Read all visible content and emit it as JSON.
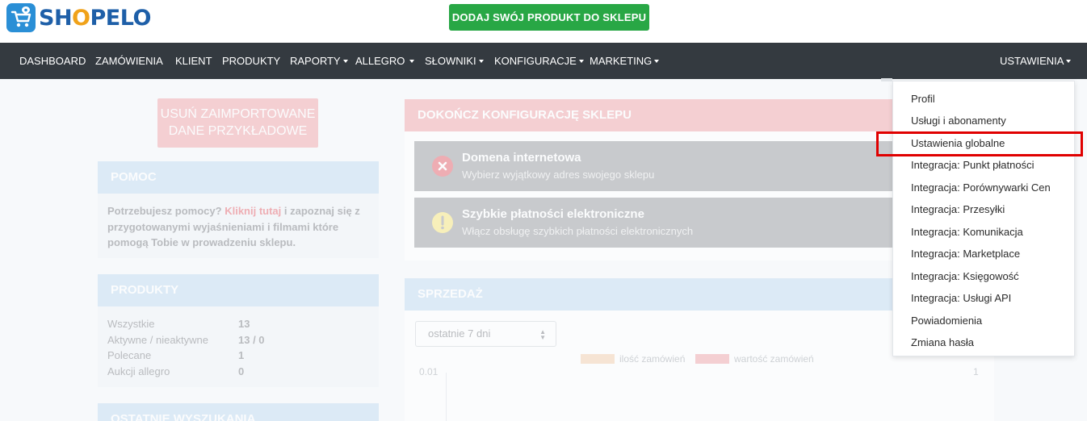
{
  "header": {
    "logo_text_a": "SH",
    "logo_text_o": "O",
    "logo_text_b": "PELO",
    "cta_label": "DODAJ SWÓJ PRODUKT DO SKLEPU"
  },
  "nav": {
    "items": [
      {
        "label": "DASHBOARD",
        "dropdown": false
      },
      {
        "label": "ZAMÓWIENIA",
        "dropdown": false
      },
      {
        "label": "KLIENT",
        "dropdown": false
      },
      {
        "label": "PRODUKTY",
        "dropdown": false
      },
      {
        "label": "RAPORTY",
        "dropdown": true
      },
      {
        "label": "ALLEGRO",
        "dropdown": true
      },
      {
        "label": "SŁOWNIKI",
        "dropdown": true
      },
      {
        "label": "KONFIGURACJE",
        "dropdown": true
      },
      {
        "label": "MARKETING",
        "dropdown": true
      }
    ],
    "settings_label": "USTAWIENIA"
  },
  "dashboard": {
    "remove_button_line1": "USUŃ ZAIMPORTOWANE",
    "remove_button_line2": "DANE PRZYKŁADOWE",
    "help": {
      "title": "POMOC",
      "text_before": "Potrzebujesz pomocy?",
      "link": "Kliknij tutaj",
      "text_after": "i zapoznaj się z przygotowanymi wyjaśnieniami i filmami które pomogą Tobie w prowadzeniu sklepu."
    },
    "products": {
      "title": "PRODUKTY",
      "rows": [
        {
          "label": "Wszystkie",
          "value": "13"
        },
        {
          "label": "Aktywne / nieaktywne",
          "value": "13 / 0"
        },
        {
          "label": "Polecane",
          "value": "1"
        },
        {
          "label": "Aukcji allegro",
          "value": "0"
        }
      ]
    },
    "recent_searches_title": "OSTATNIE WYSZUKANIA",
    "config": {
      "title": "DOKOŃCZ KONFIGURACJĘ SKLEPU",
      "tasks": [
        {
          "title": "Domena internetowa",
          "subtitle": "Wybierz wyjątkowy adres swojego sklepu",
          "icon": "error-circle-icon"
        },
        {
          "title": "Szybkie płatności elektroniczne",
          "subtitle": "Włącz obsługę szybkich płatności elektronicznych",
          "icon": "warning-circle-icon"
        }
      ]
    },
    "sales": {
      "title": "SPRZEDAŻ",
      "period_select": "ostatnie 7 dni",
      "legend": [
        {
          "label": "ilość zamówień",
          "color": "#f3c9a4"
        },
        {
          "label": "wartość zamówień",
          "color": "#ef9aa0"
        }
      ],
      "y_left_top": "0.01",
      "y_right_top": "1"
    }
  },
  "settings_menu": {
    "items": [
      "Profil",
      "Usługi i abonamenty",
      "Ustawienia globalne",
      "Integracja: Punkt płatności",
      "Integracja: Porównywarki Cen",
      "Integracja: Przesyłki",
      "Integracja: Komunikacja",
      "Integracja: Marketplace",
      "Integracja: Księgowość",
      "Integracja: Usługi API",
      "Powiadomienia",
      "Zmiana hasła"
    ],
    "highlighted": "Ustawienia globalne"
  },
  "colors": {
    "navbar": "#343a40",
    "cta": "#28a745",
    "highlight": "#e00000"
  }
}
